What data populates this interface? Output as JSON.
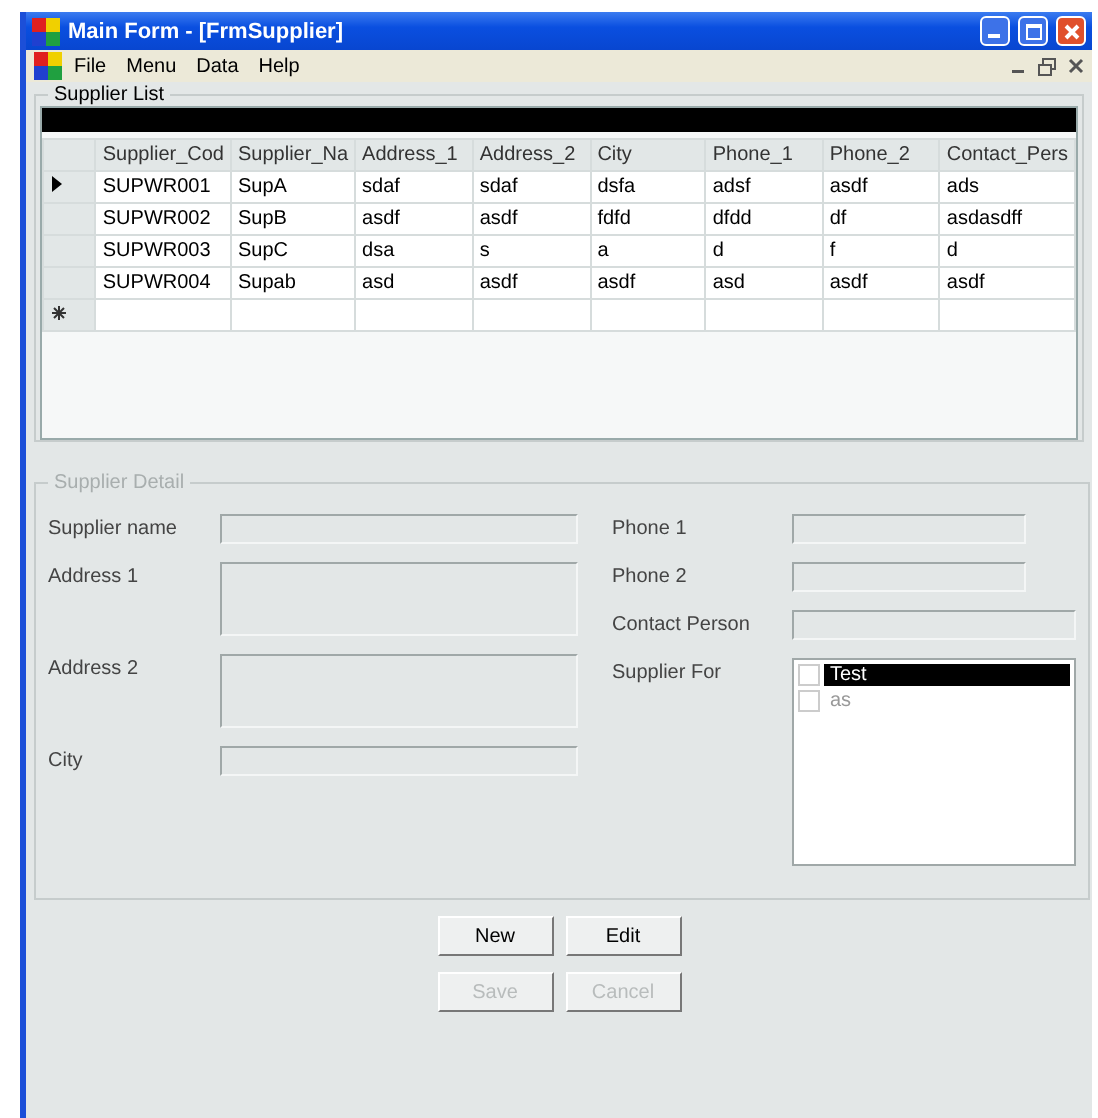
{
  "window": {
    "title": "Main Form - [FrmSupplier]"
  },
  "menu": [
    "File",
    "Menu",
    "Data",
    "Help"
  ],
  "supplier_list": {
    "title": "Supplier List",
    "columns": [
      "Supplier_Cod",
      "Supplier_Na",
      "Address_1",
      "Address_2",
      "City",
      "Phone_1",
      "Phone_2",
      "Contact_Pers"
    ],
    "rows": [
      {
        "kind": "data",
        "selected": true,
        "cells": [
          "SUPWR001",
          "SupA",
          "sdaf",
          "sdaf",
          "dsfa",
          "adsf",
          "asdf",
          "ads"
        ]
      },
      {
        "kind": "data",
        "selected": false,
        "cells": [
          "SUPWR002",
          "SupB",
          "asdf",
          "asdf",
          "fdfd",
          "dfdd",
          "df",
          "asdasdff"
        ]
      },
      {
        "kind": "data",
        "selected": false,
        "cells": [
          "SUPWR003",
          "SupC",
          "dsa",
          "s",
          "a",
          "d",
          "f",
          "d"
        ]
      },
      {
        "kind": "data",
        "selected": false,
        "cells": [
          "SUPWR004",
          "Supab",
          "asd",
          "asdf",
          "asdf",
          "asd",
          "asdf",
          "asdf"
        ]
      },
      {
        "kind": "new",
        "selected": false,
        "cells": []
      }
    ]
  },
  "supplier_detail": {
    "title": "Supplier Detail",
    "left_fields": [
      {
        "label": "Supplier name",
        "kind": "text"
      },
      {
        "label": "Address 1",
        "kind": "multiline"
      },
      {
        "label": "Address 2",
        "kind": "multiline"
      },
      {
        "label": "City",
        "kind": "text"
      }
    ],
    "right_fields": [
      {
        "label": "Phone 1",
        "kind": "short"
      },
      {
        "label": "Phone 2",
        "kind": "short"
      },
      {
        "label": "Contact Person",
        "kind": "text"
      },
      {
        "label": "Supplier For",
        "kind": "checklist",
        "items": [
          {
            "text": "Test",
            "checked": false,
            "selected": true
          },
          {
            "text": "as",
            "checked": false,
            "selected": false
          }
        ]
      }
    ]
  },
  "buttons": [
    {
      "label": "New",
      "disabled": false
    },
    {
      "label": "Edit",
      "disabled": false
    },
    {
      "label": "Save",
      "disabled": true
    },
    {
      "label": "Cancel",
      "disabled": true
    }
  ]
}
